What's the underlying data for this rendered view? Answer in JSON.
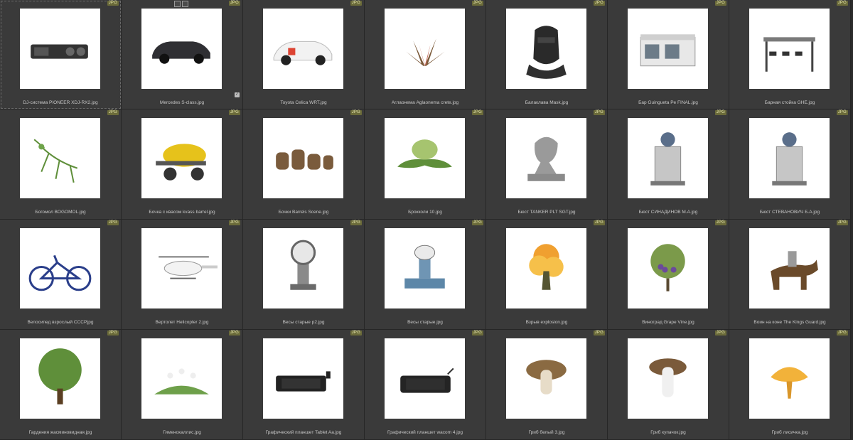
{
  "badge_label": "JPG",
  "items": [
    {
      "name": "DJ-система PIONEER XDJ-RX2.jpg",
      "icon": "dj-controller"
    },
    {
      "name": "Mercedes S-class.jpg",
      "icon": "car-sedan"
    },
    {
      "name": "Toyota Celica WRT.jpg",
      "icon": "rally-car"
    },
    {
      "name": "Аглаонема Aglaonema crete.jpg",
      "icon": "plant"
    },
    {
      "name": "Балаклава Mask.jpg",
      "icon": "balaclava"
    },
    {
      "name": "Бар Guingueta Pe FINAL.jpg",
      "icon": "kiosk"
    },
    {
      "name": "Барная стойка GHE.jpg",
      "icon": "bar-table"
    },
    {
      "name": "Богомол BOGOMOL.jpg",
      "icon": "mantis"
    },
    {
      "name": "Бочка с квасом kvass barrel.jpg",
      "icon": "barrel-cart"
    },
    {
      "name": "Бочки Barrels Scene.jpg",
      "icon": "barrels"
    },
    {
      "name": "Брокколи 10.jpg",
      "icon": "broccoli"
    },
    {
      "name": "Бюст TANKER PLT SGT.jpg",
      "icon": "bust"
    },
    {
      "name": "Бюст СИНАДИНОВ М.А.jpg",
      "icon": "monument"
    },
    {
      "name": "Бюст СТЕВАНОВИЧ Б.А.jpg",
      "icon": "monument"
    },
    {
      "name": "Велосипед взрослый СССР.jpg",
      "icon": "bicycle"
    },
    {
      "name": "Вертолет Helicopter 2.jpg",
      "icon": "helicopter"
    },
    {
      "name": "Весы старые p2.jpg",
      "icon": "scale-dial"
    },
    {
      "name": "Весы старые.jpg",
      "icon": "scale-blue"
    },
    {
      "name": "Взрыв explosion.jpg",
      "icon": "explosion"
    },
    {
      "name": "Виноград Grape Vine.jpg",
      "icon": "grape-vine"
    },
    {
      "name": "Воин на коне The Kings Guard.jpg",
      "icon": "horse-rider"
    },
    {
      "name": "Гардения жасминовидная.jpg",
      "icon": "tree"
    },
    {
      "name": "Гименокаллис.jpg",
      "icon": "flowers"
    },
    {
      "name": "Графический планшет Tablet Aa.jpg",
      "icon": "tablet"
    },
    {
      "name": "Графический планшет wacom 4.jpg",
      "icon": "tablet2"
    },
    {
      "name": "Гриб белый 3.jpg",
      "icon": "mushroom-porcini"
    },
    {
      "name": "Гриб купачок.jpg",
      "icon": "mushroom"
    },
    {
      "name": "Гриб лисичка.jpg",
      "icon": "chanterelle"
    }
  ]
}
